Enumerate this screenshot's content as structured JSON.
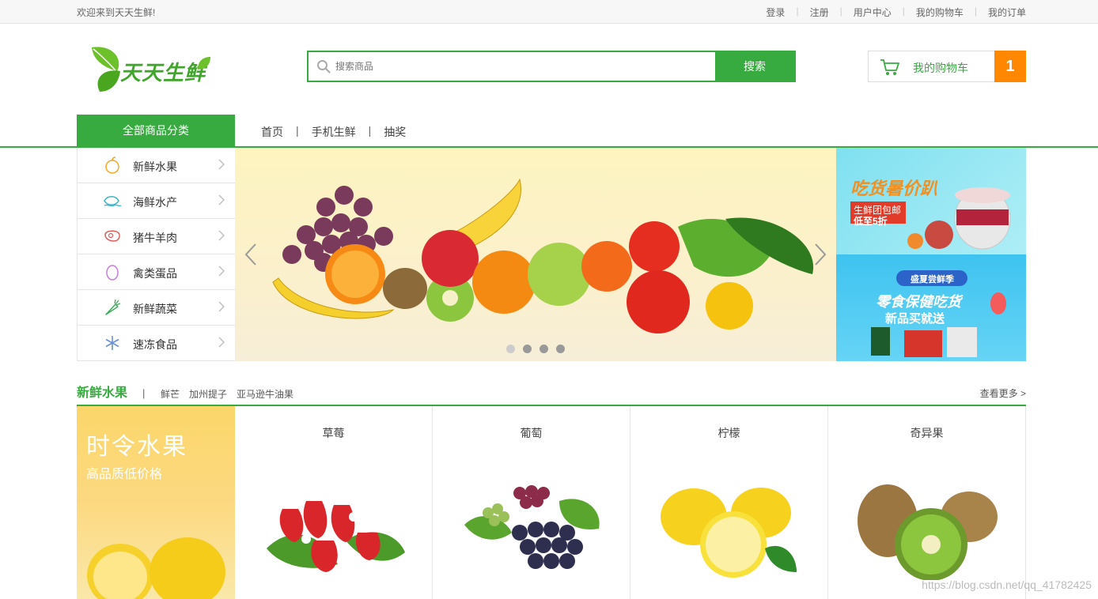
{
  "topbar": {
    "welcome": "欢迎来到天天生鲜!",
    "links": [
      "登录",
      "注册",
      "用户中心",
      "我的购物车",
      "我的订单"
    ]
  },
  "logo": {
    "text": "天天生鲜"
  },
  "search": {
    "placeholder": "搜索商品",
    "button": "搜索"
  },
  "cart": {
    "label": "我的购物车",
    "count": "1"
  },
  "nav": {
    "all_categories": "全部商品分类",
    "links": [
      "首页",
      "手机生鲜",
      "抽奖"
    ]
  },
  "categories": [
    {
      "label": "新鲜水果",
      "icon": "apple-icon"
    },
    {
      "label": "海鲜水产",
      "icon": "fish-icon"
    },
    {
      "label": "猪牛羊肉",
      "icon": "meat-icon"
    },
    {
      "label": "禽类蛋品",
      "icon": "egg-icon"
    },
    {
      "label": "新鲜蔬菜",
      "icon": "carrot-icon"
    },
    {
      "label": "速冻食品",
      "icon": "snowflake-icon"
    }
  ],
  "banner": {
    "dots": 4,
    "active_dot": 0
  },
  "ads": [
    {
      "line1": "吃货暑价趴",
      "line2": "生鲜团包邮",
      "line3": "低至5折"
    },
    {
      "line1": "盛夏尝鲜季",
      "line2": "零食保健吃货",
      "line3": "新品买就送"
    }
  ],
  "section": {
    "title": "新鲜水果",
    "links": [
      "鲜芒",
      "加州提子",
      "亚马逊牛油果"
    ],
    "more": "查看更多 >",
    "promo_title": "时令水果",
    "promo_sub": "高品质低价格",
    "products": [
      "草莓",
      "葡萄",
      "柠檬",
      "奇异果"
    ]
  },
  "watermark": "https://blog.csdn.net/qq_41782425",
  "colors": {
    "accent": "#37ab40",
    "orange": "#ff8800"
  }
}
